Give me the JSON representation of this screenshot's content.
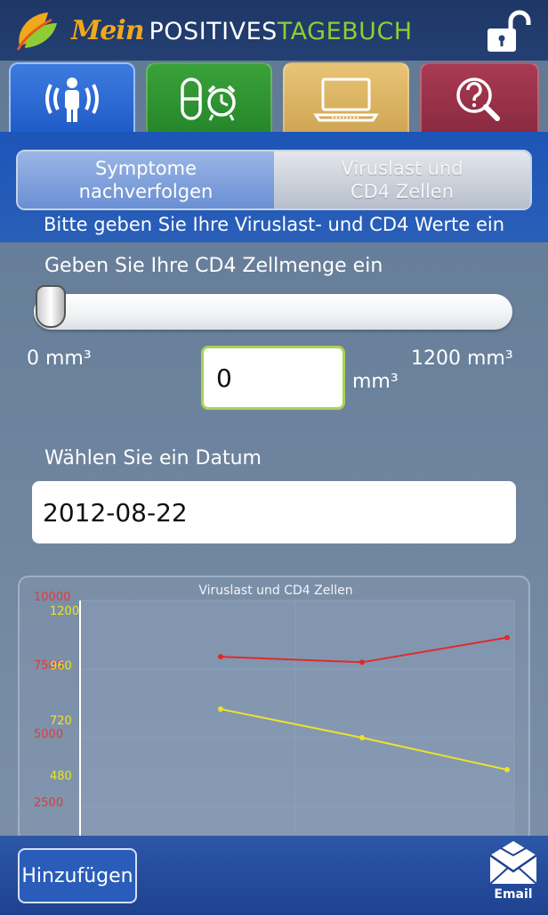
{
  "header": {
    "title_part1": "Mein",
    "title_part2": "POSITIVES",
    "title_part3": "TAGEBUCH",
    "logo_icon": "leaf-logo-icon",
    "lock_icon": "unlocked-padlock-icon"
  },
  "tabs": [
    {
      "icon": "person-signal-icon",
      "color": "#2b6ad6",
      "active": true
    },
    {
      "icon": "pill-alarm-clock-icon",
      "color": "#2f962f",
      "active": false
    },
    {
      "icon": "laptop-icon",
      "color": "#dcb565",
      "active": false
    },
    {
      "icon": "question-magnifier-icon",
      "color": "#9b3249",
      "active": false
    }
  ],
  "subtabs": [
    {
      "label": "Symptome nachverfolgen",
      "active": true
    },
    {
      "label": "Viruslast und CD4 Zellen",
      "active": false
    }
  ],
  "instruction": "Bitte geben Sie Ihre Viruslast- und CD4 Werte ein",
  "cd4": {
    "label": "Geben Sie Ihre CD4 Zellmenge ein",
    "min_label": "0 mm³",
    "max_label": "1200 mm³",
    "value": "0",
    "unit": "mm³",
    "slider_fraction": 0
  },
  "date": {
    "label": "Wählen Sie ein Datum",
    "value": "2012-08-22"
  },
  "chart_data": {
    "type": "line",
    "title": "Viruslast und CD4 Zellen",
    "left_axis_ticks": [
      "10000",
      "7500",
      "5000",
      "2500"
    ],
    "right_axis_ticks": [
      "1200",
      "960",
      "720",
      "480"
    ],
    "ylim_viral": [
      0,
      10000
    ],
    "ylim_cd4": [
      0,
      1200
    ],
    "grid": true,
    "series": [
      {
        "color": "#e02a2a",
        "axis": "viral",
        "values": [
          7950,
          7750,
          8650
        ]
      },
      {
        "color": "#ebe32a",
        "axis": "cd4",
        "values": [
          725,
          600,
          460
        ]
      }
    ]
  },
  "footer": {
    "add_label": "Hinzufügen",
    "email_label": "Email"
  }
}
